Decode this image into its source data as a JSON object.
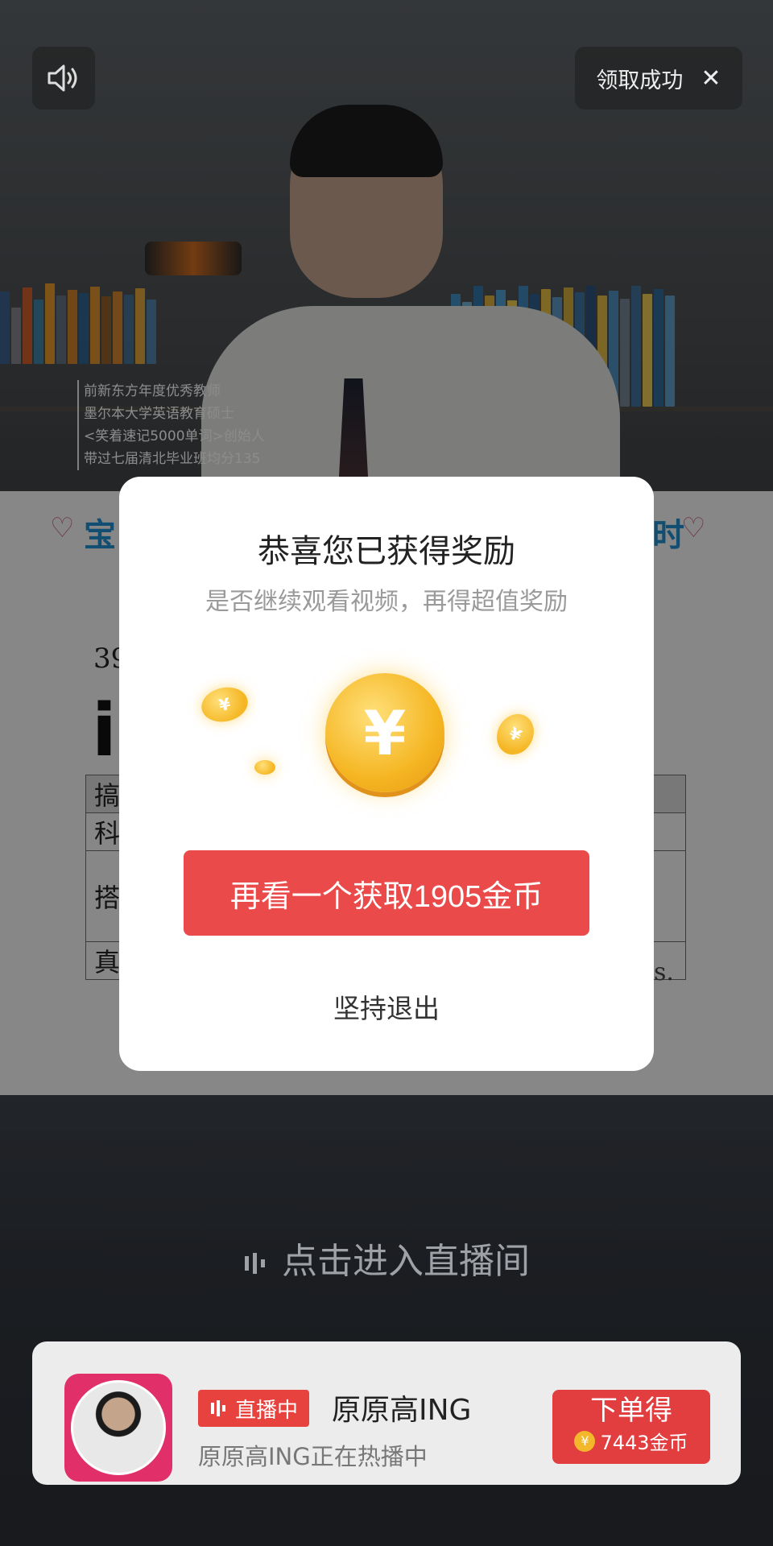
{
  "top_bar": {
    "sound_icon": "speaker-icon",
    "reward_status_text": "领取成功",
    "close_icon": "close-icon"
  },
  "video": {
    "teacher_intro": [
      "前新东方年度优秀教师",
      "墨尔本大学英语教育硕士",
      "<笑着速记5000单词>创始人",
      "带过七届清北毕业班均分135"
    ]
  },
  "document": {
    "brand_left": "宝",
    "brand_right": "时",
    "number_fragment": "39",
    "big_letters": "i",
    "table_rows": [
      "搞",
      "科",
      "搭",
      "真"
    ],
    "tail_text": "s."
  },
  "modal": {
    "title": "恭喜您已获得奖励",
    "subtitle": "是否继续观看视频，再得超值奖励",
    "coin_symbol": "¥",
    "cta_label": "再看一个获取1905金币",
    "quit_label": "坚持退出"
  },
  "live": {
    "enter_text": "点击进入直播间",
    "badge_label": "直播中",
    "anchor_name": "原原高ING",
    "status_text": "原原高ING正在热播中",
    "order_title": "下单得",
    "order_coins": "7443金币",
    "coin_symbol": "¥"
  },
  "colors": {
    "accent_red": "#ea4a4a",
    "coin_gold": "#f5b623",
    "avatar_frame": "#e12f6a"
  }
}
